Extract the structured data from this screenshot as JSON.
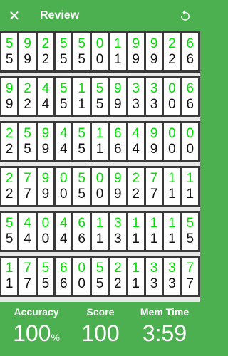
{
  "header": {
    "title": "Review"
  },
  "rows": [
    {
      "answer": "59255019926",
      "recall": "59255019926"
    },
    {
      "answer": "92451593306",
      "recall": "92451593306"
    },
    {
      "answer": "25945164900",
      "recall": "25945164900"
    },
    {
      "answer": "27905092711",
      "recall": "27905092711"
    },
    {
      "answer": "54046131115",
      "recall": "54046131115"
    },
    {
      "answer": "17560521337",
      "recall": "17560521337"
    }
  ],
  "footer": {
    "accuracy_label": "Accuracy",
    "accuracy_value": "100",
    "accuracy_unit": "%",
    "score_label": "Score",
    "score_value": "100",
    "memtime_label": "Mem Time",
    "memtime_value": "3:59"
  },
  "colors": {
    "header": "#4caf50",
    "answer_digit": "#00e000",
    "recall_digit": "#111111"
  },
  "icons": {
    "close": "close-icon",
    "reset": "reset-icon"
  }
}
